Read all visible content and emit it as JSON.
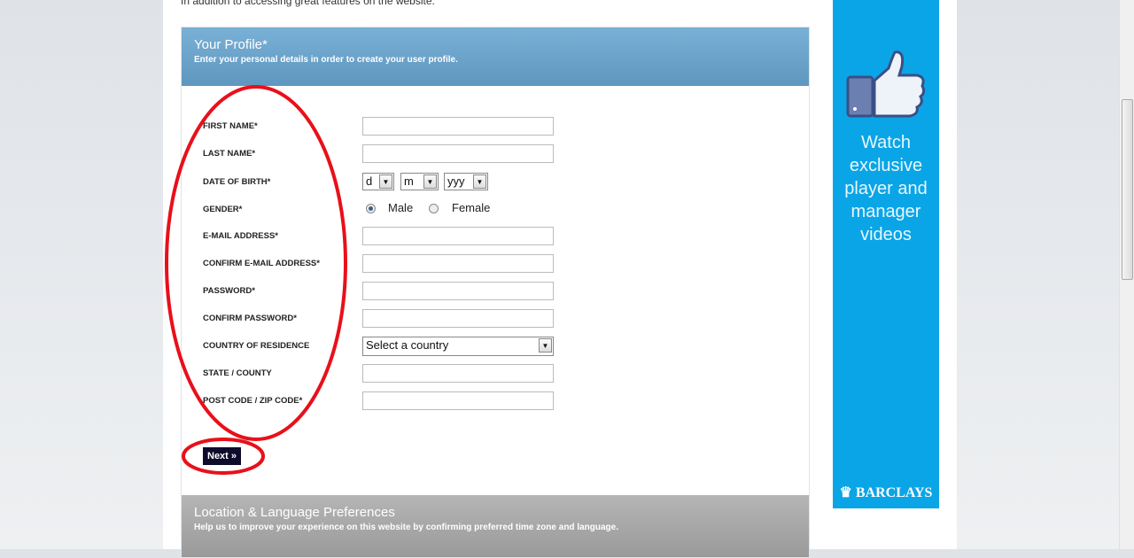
{
  "intro_text": "In addition to accessing great features on the website.",
  "profile": {
    "title": "Your Profile*",
    "subtitle": "Enter your personal details in order to create your user profile.",
    "fields": {
      "first_name": "FIRST NAME*",
      "last_name": "LAST NAME*",
      "dob": "DATE OF BIRTH*",
      "gender": "GENDER*",
      "email": "E-MAIL ADDRESS*",
      "confirm_email": "CONFIRM E-MAIL ADDRESS*",
      "password": "PASSWORD*",
      "confirm_password": "CONFIRM PASSWORD*",
      "country": "COUNTRY OF RESIDENCE",
      "state": "STATE / COUNTY",
      "postcode": "POST CODE / ZIP CODE*"
    },
    "dob": {
      "day": "d",
      "month": "m",
      "year": "yyy"
    },
    "gender": {
      "male": "Male",
      "female": "Female",
      "selected": "Male"
    },
    "country_value": "Select a country",
    "next_label": "Next »"
  },
  "location": {
    "title": "Location & Language Preferences",
    "subtitle": "Help us to improve your experience on this website by confirming preferred time zone and language."
  },
  "ad": {
    "text": "Watch exclusive player and manager videos",
    "brand": "BARCLAYS",
    "icon": "thumbs-up-icon",
    "color": "#0aa5e6"
  },
  "annotation_color": "#e8101a"
}
